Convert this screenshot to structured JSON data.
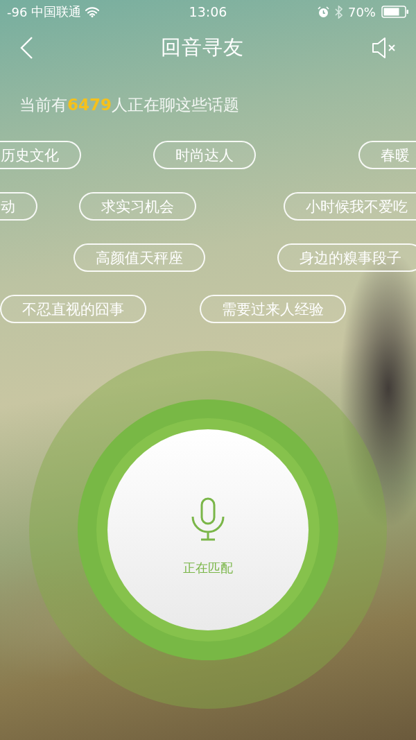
{
  "status_bar": {
    "signal": "-96",
    "carrier": "中国联通",
    "time": "13:06",
    "battery": "70%"
  },
  "nav": {
    "title": "回音寻友"
  },
  "subtitle": "当前有**6479**人正在聊这些话题",
  "topic_rows": [
    [
      "历史文化",
      "时尚达人",
      "春暖"
    ],
    [
      "动",
      "求实习机会",
      "小时候我不爱吃"
    ],
    [
      "高颜值天秤座",
      "身边的糗事段子"
    ],
    [
      "不忍直视的囧事",
      "需要过来人经验"
    ]
  ],
  "match_button": {
    "label": "正在匹配"
  }
}
